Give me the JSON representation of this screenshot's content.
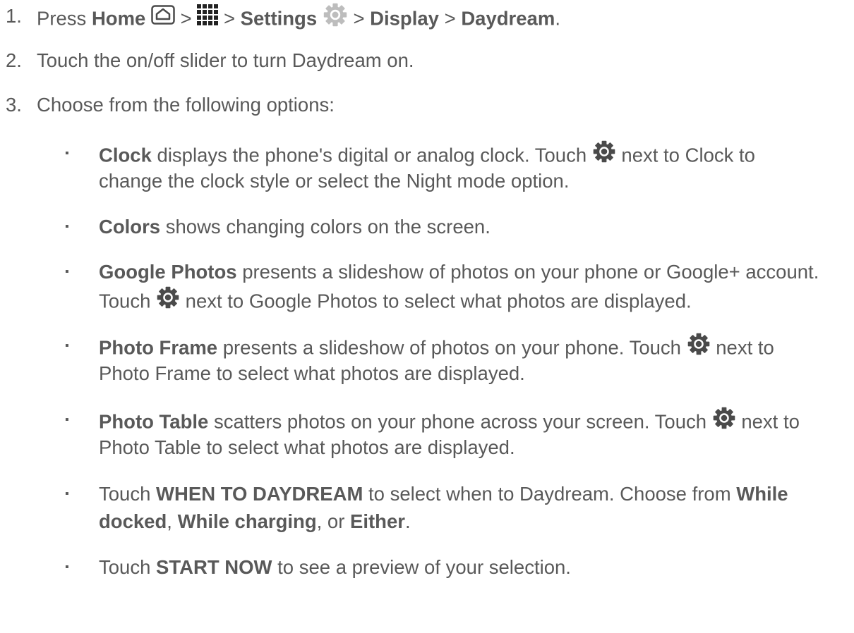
{
  "steps": [
    {
      "number": "1.",
      "parts": [
        "Press",
        "Home",
        ">",
        ">",
        "Settings",
        ">",
        "Display",
        ">",
        "Daydream",
        "."
      ]
    },
    {
      "number": "2.",
      "text": "Touch the on/off slider to turn Daydream on."
    },
    {
      "number": "3.",
      "text": "Choose from the following options:"
    }
  ],
  "bullets": [
    {
      "name": "Clock",
      "line1a": " displays the phone's digital or analog clock. Touch ",
      "line1b": " next to Clock to",
      "line2": "change the clock style or select the Night mode option."
    },
    {
      "name": "Colors",
      "line1a": " shows changing colors on the screen."
    },
    {
      "name": "Google Photos",
      "line1a": " presents a slideshow of photos on your phone or Google+ account.",
      "line2a": "Touch ",
      "line2b": " next to Google Photos to select what photos are displayed."
    },
    {
      "name": "Photo Frame",
      "line1a": " presents a slideshow of photos on your phone. Touch ",
      "line1b": " next to",
      "line2": "Photo Frame to select what photos are displayed."
    },
    {
      "name": "Photo Table",
      "line1a": " scatters photos on your phone across your screen. Touch ",
      "line1b": " next to",
      "line2": "Photo Table to select what photos are displayed."
    },
    {
      "line1a": "Touch ",
      "strong1": "WHEN TO DAYDREAM",
      "line1b": " to select when to Daydream. Choose from ",
      "strong2": "While",
      "strong3": "docked",
      "line2a": ", ",
      "strong4": "While charging",
      "line2b": ", or ",
      "strong5": "Either",
      "line2c": "."
    },
    {
      "line1a": "Touch ",
      "strong1": "START NOW",
      "line1b": " to see a preview of your selection."
    }
  ],
  "bullet_glyph": "▪",
  "icons": {
    "home": "home-icon",
    "apps": "apps-grid-icon",
    "settings": "settings-gear-icon",
    "gear": "gear-icon"
  },
  "colors": {
    "text": "#595959",
    "icon": "#4a4a4a",
    "settings_icon": "#bdbdbd"
  }
}
